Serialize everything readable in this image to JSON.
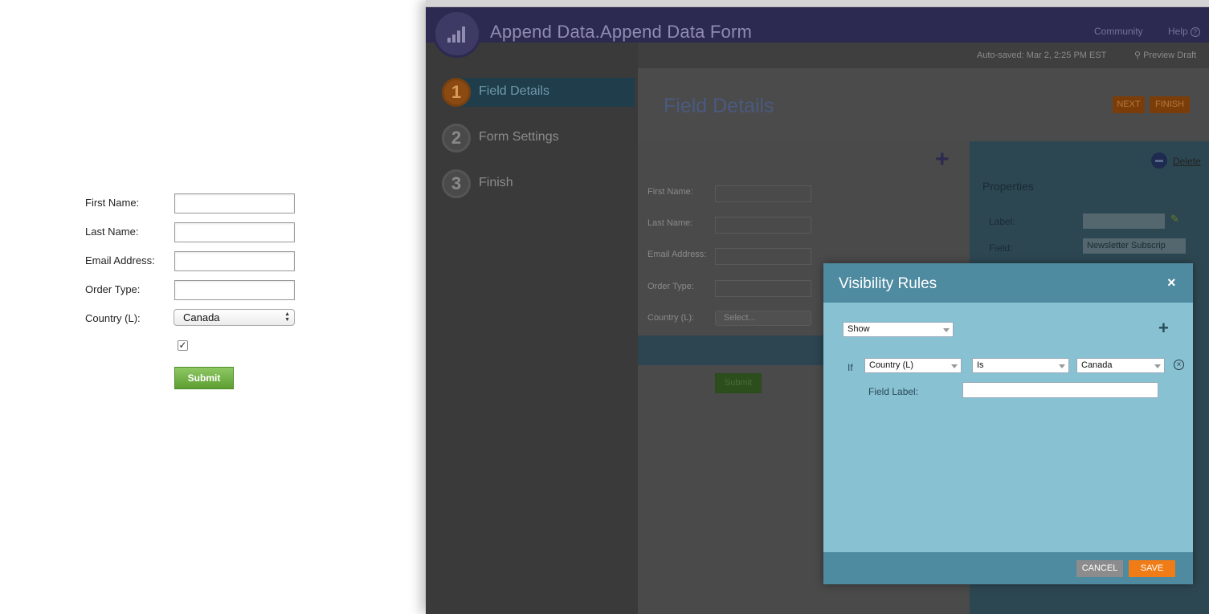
{
  "preview_form": {
    "first_name_label": "First Name:",
    "last_name_label": "Last Name:",
    "email_label": "Email Address:",
    "order_type_label": "Order Type:",
    "country_label": "Country (L):",
    "country_value": "Canada",
    "checkbox_checked": true,
    "checkbox_mark": "✓",
    "submit_label": "Submit"
  },
  "editor": {
    "title": "Append Data.Append Data Form",
    "header_links": {
      "community": "Community",
      "help": "Help",
      "help_icon": "?"
    },
    "autosaved": "Auto-saved: Mar 2, 2:25 PM EST",
    "preview_draft": "Preview Draft",
    "steps": [
      {
        "number": "1",
        "label": "Field Details",
        "active": true
      },
      {
        "number": "2",
        "label": "Form Settings",
        "active": false
      },
      {
        "number": "3",
        "label": "Finish",
        "active": false
      }
    ],
    "page_title": "Field Details",
    "next_label": "NEXT",
    "finish_label": "FINISH",
    "canvas": {
      "fields": [
        "First Name:",
        "Last Name:",
        "Email Address:",
        "Order Type:",
        "Country (L):"
      ],
      "country_select_value": "Select...",
      "submit_label": "Submit"
    },
    "properties": {
      "delete_label": "Delete",
      "title": "Properties",
      "label_label": "Label:",
      "field_label": "Field:",
      "field_value": "Newsletter Subscrip"
    }
  },
  "modal": {
    "title": "Visibility Rules",
    "close_glyph": "×",
    "action_value": "Show",
    "add_rule_glyph": "+",
    "if_label": "If",
    "rule_field_value": "Country (L)",
    "rule_operator_value": "Is",
    "rule_value": "Canada",
    "remove_glyph": "×",
    "field_label_label": "Field Label:",
    "field_label_value": "",
    "cancel_label": "CANCEL",
    "save_label": "SAVE"
  },
  "colors": {
    "header_bg": "#2c2a50",
    "modal_bg": "#87c1d2",
    "modal_head": "#4e8aa0",
    "save_orange": "#f07c17",
    "submit_green": "#6aab3c"
  },
  "icons": [
    "marketo-logo-icon",
    "help-icon",
    "search-icon",
    "add-field-icon",
    "delete-icon",
    "pencil-icon",
    "close-icon",
    "add-rule-icon",
    "remove-rule-icon",
    "dropdown-caret-icon"
  ]
}
